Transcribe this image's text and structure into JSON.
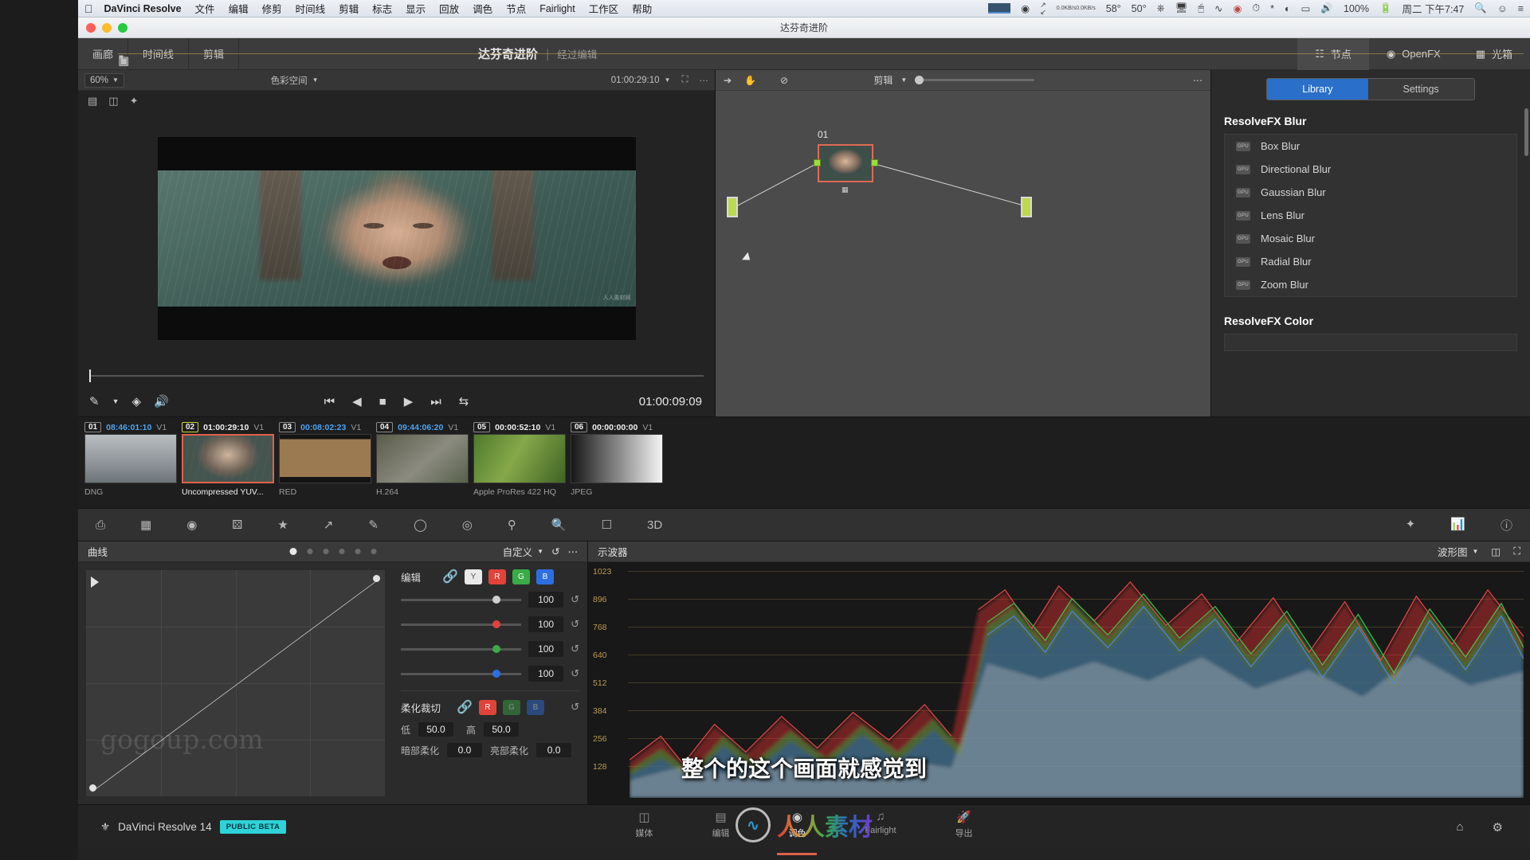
{
  "macbar": {
    "apple_icon": "apple-icon",
    "app_name": "DaVinci Resolve",
    "menus": [
      "文件",
      "编辑",
      "修剪",
      "时间线",
      "剪辑",
      "标志",
      "显示",
      "回放",
      "调色",
      "节点",
      "Fairlight",
      "工作区",
      "帮助"
    ],
    "net_up": "0.0KB/s",
    "net_down": "0.0KB/s",
    "temp_1": "58°",
    "temp_2": "50°",
    "battery_percent": "100%",
    "datetime": "周二 下午7:47",
    "right_icons": [
      "display-swatch",
      "creative-cloud-icon",
      "arrows-icon",
      "network-speed",
      "thermometer-icon",
      "display-icon",
      "mouse-icon",
      "flux-icon",
      "record-icon",
      "timemachine-icon",
      "bluetooth-icon",
      "wifi-icon",
      "airplay-icon",
      "volume-icon",
      "battery-icon",
      "search-icon",
      "user-icon",
      "control-center-icon"
    ]
  },
  "window": {
    "title": "达芬奇进阶"
  },
  "toolbar": {
    "gallery": "画廊",
    "timeline": "时间线",
    "clip": "剪辑",
    "project_name": "达芬奇进阶",
    "project_timeline": "经过编辑",
    "nodes": "节点",
    "openfx": "OpenFX",
    "lightbox": "光箱"
  },
  "viewer": {
    "zoom": "60%",
    "colorspace": "色彩空间",
    "timecode_top": "01:00:29:10",
    "timecode_current": "01:00:09:09",
    "watermark": "人人素材网",
    "tools": [
      "picker-icon",
      "chevron-down-icon",
      "layers-icon",
      "audio-icon"
    ],
    "transport": [
      "skip-back-icon",
      "step-back-icon",
      "stop-icon",
      "play-icon",
      "skip-forward-icon",
      "loop-icon"
    ]
  },
  "nodegraph": {
    "mode": "剪辑",
    "node_label": "01"
  },
  "fx": {
    "tab_library": "Library",
    "tab_settings": "Settings",
    "group_blur": "ResolveFX Blur",
    "group_color": "ResolveFX Color",
    "badge": "GPU",
    "blur_items": [
      "Box Blur",
      "Directional Blur",
      "Gaussian Blur",
      "Lens Blur",
      "Mosaic Blur",
      "Radial Blur",
      "Zoom Blur"
    ]
  },
  "clips": [
    {
      "num": "01",
      "tc": "08:46:01:10",
      "track": "V1",
      "label": "DNG",
      "selected": false,
      "tc_blue": true
    },
    {
      "num": "02",
      "tc": "01:00:29:10",
      "track": "V1",
      "label": "Uncompressed YUV...",
      "selected": true,
      "tc_blue": false
    },
    {
      "num": "03",
      "tc": "00:08:02:23",
      "track": "V1",
      "label": "RED",
      "selected": false,
      "tc_blue": true
    },
    {
      "num": "04",
      "tc": "09:44:06:20",
      "track": "V1",
      "label": "H.264",
      "selected": false,
      "tc_blue": true
    },
    {
      "num": "05",
      "tc": "00:00:52:10",
      "track": "V1",
      "label": "Apple ProRes 422 HQ",
      "selected": false,
      "tc_blue": false
    },
    {
      "num": "06",
      "tc": "00:00:00:00",
      "track": "V1",
      "label": "JPEG",
      "selected": false,
      "tc_blue": false
    }
  ],
  "iconbar": {
    "icons": [
      "printer-icon",
      "stills-icon",
      "record-icon",
      "tracker-icon",
      "star-icon",
      "curves-icon",
      "qualifier-icon",
      "window-icon",
      "blur-icon",
      "key-icon",
      "sizing-icon",
      "magnifier-icon",
      "data-burn-icon",
      "stereo-3d-icon",
      "magic-mask-icon",
      "scopes-icon",
      "info-icon"
    ]
  },
  "curves": {
    "title": "曲线",
    "preset": "自定义",
    "edit_label": "编辑",
    "channels": [
      "Y",
      "R",
      "G",
      "B"
    ],
    "values": [
      "100",
      "100",
      "100",
      "100"
    ],
    "soft_clip_label": "柔化裁切",
    "soft_channels": [
      "R",
      "G",
      "B"
    ],
    "rows": [
      {
        "l1": "低",
        "v1": "50.0",
        "l2": "高",
        "v2": "50.0"
      },
      {
        "l1": "暗部柔化",
        "v1": "0.0",
        "l2": "亮部柔化",
        "v2": "0.0"
      }
    ],
    "watermark": "gogoup.com"
  },
  "scope": {
    "title": "示波器",
    "mode": "波形图",
    "axis": [
      "1023",
      "896",
      "768",
      "640",
      "512",
      "384",
      "256",
      "128"
    ]
  },
  "subtitle": "整个的这个画面就感觉到",
  "status": {
    "app": "DaVinci Resolve 14",
    "badge": "PUBLIC BETA",
    "pages": [
      {
        "label": "媒体",
        "icon": "media-page-icon",
        "active": false
      },
      {
        "label": "编辑",
        "icon": "edit-page-icon",
        "active": false
      },
      {
        "label": "调色",
        "icon": "color-page-icon",
        "active": true
      },
      {
        "label": "Fairlight",
        "icon": "fairlight-page-icon",
        "active": false
      },
      {
        "label": "导出",
        "icon": "deliver-page-icon",
        "active": false
      }
    ],
    "right_icons": [
      "home-icon",
      "settings-icon"
    ]
  },
  "watermark_logo": {
    "mark": "人人素材"
  }
}
